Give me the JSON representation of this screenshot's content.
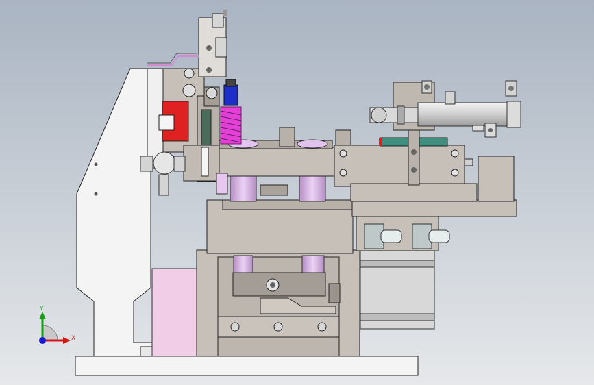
{
  "view": {
    "background_top": "#a9b4c2",
    "background_bottom": "#e6e8ea"
  },
  "triad": {
    "x_label": "X",
    "y_label": "Y",
    "x_color": "#d11b1b",
    "y_color": "#1e9a1e",
    "z_color": "#1b1bcc"
  },
  "palette": {
    "metal_light": "#c6c0b9",
    "metal_dark": "#9f9891",
    "plate_white": "#f4f4f4",
    "bearing_pink": "#d7b3e3",
    "spring_magenta": "#e43fd6",
    "red_block": "#e02121",
    "motor_grey": "#d8d8d8",
    "fitting_grey": "#bfc8c8",
    "pink_panel": "#f2cde8"
  }
}
